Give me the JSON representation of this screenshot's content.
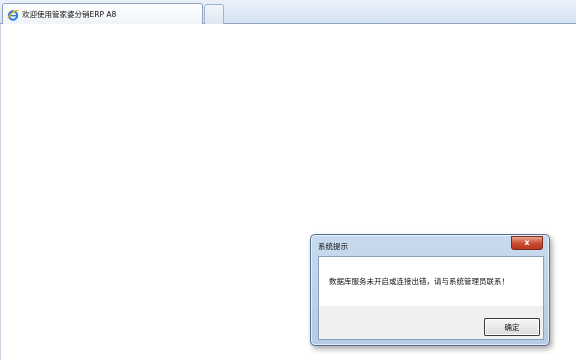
{
  "browser": {
    "active_tab": {
      "title": "欢迎使用管家婆分销ERP A8",
      "icon": "ie-icon"
    },
    "new_tab": {
      "icon": "new-tab-icon"
    },
    "colors": {
      "tabstrip": "#d7e3f1",
      "content_background": "#ffffff"
    }
  },
  "dialog": {
    "title": "系统提示",
    "message": "数据库服务未开启或连接出错，请与系统管理员联系！",
    "ok_label": "确定",
    "close_icon": "close-icon",
    "close_glyph": "x",
    "colors": {
      "frame": "#b5cbe3",
      "close_button": "#c84a2f"
    }
  }
}
